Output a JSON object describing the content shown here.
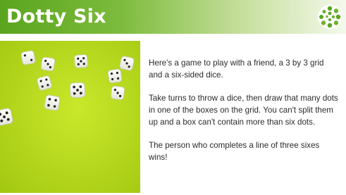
{
  "header": {
    "title": "Dotty Six",
    "background_color": "#5aa51e",
    "logo_icon": "green-spiral-logo-icon"
  },
  "image": {
    "subject": "dice-on-green-background",
    "background_color": "#bfe21c"
  },
  "body": {
    "paragraphs": [
      "Here's a game to play with a friend, a 3 by 3 grid and a six-sided dice.",
      "Take turns to throw a dice, then draw that many dots in one of the boxes on the grid. You can't split them up and a box can't contain more than six dots.",
      "The person who completes a line of three sixes wins!"
    ]
  }
}
